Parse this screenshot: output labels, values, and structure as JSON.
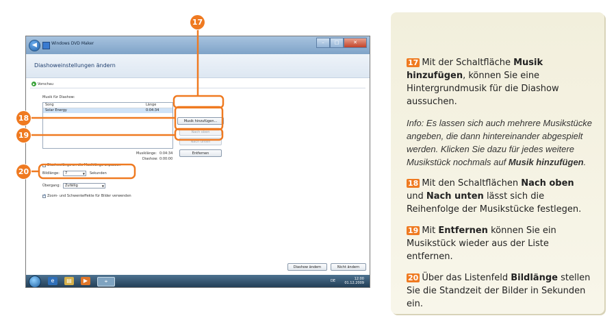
{
  "window": {
    "title": "Windows DVD Maker",
    "heading": "Diashoweinstellungen ändern",
    "preview_label": "Vorschau"
  },
  "music": {
    "section_label": "Musik für Diashow:",
    "columns": [
      "Song",
      "Länge"
    ],
    "rows": [
      {
        "song": "Solar Energy",
        "length": "0:04:34"
      }
    ],
    "add_button": "Musik hinzufügen...",
    "up_button": "Nach oben",
    "down_button": "Nach unten",
    "remove_button": "Entfernen",
    "music_length_label": "Musiklänge:",
    "music_length_value": "0:04:34",
    "slideshow_label": "Diashow:",
    "slideshow_value": "0:00:00"
  },
  "settings": {
    "fit_length_label": "Diashowlänge an die Musiklänge anpassen",
    "fit_length_checked": false,
    "picture_length_label": "Bildlänge:",
    "picture_length_value": "7",
    "picture_length_unit": "Sekunden",
    "transition_label": "Übergang:",
    "transition_value": "Zufällig",
    "zoom_label": "Zoom- und Schwenkeffekte für Bilder verwenden",
    "zoom_checked": true
  },
  "footer": {
    "change_button": "Diashow ändern",
    "cancel_button": "Nicht ändern"
  },
  "taskbar": {
    "language": "DE",
    "time": "12:00",
    "date": "01.12.2009"
  },
  "callouts": [
    "17",
    "18",
    "19",
    "20"
  ],
  "accent_color": "#ef7a21",
  "panel": {
    "p17_num": "17",
    "p17_pre": "Mit der Schaltfläche ",
    "p17_bold": "Musik hinzufügen",
    "p17_post": ", können Sie eine Hintergrundmusik für die Diashow aussuchen.",
    "info_pre": "Info: Es lassen sich auch mehrere Musikstücke angeben, die dann hintereinander abgespielt werden. Klicken Sie dazu für jedes weitere Musikstück nochmals auf ",
    "info_bold": "Musik hinzufügen",
    "info_post": ".",
    "p18_num": "18",
    "p18_pre": "Mit den Schaltflächen ",
    "p18_bold1": "Nach oben",
    "p18_mid": " und ",
    "p18_bold2": "Nach unten",
    "p18_post": " lässt sich die Reihenfolge der Musikstücke festlegen.",
    "p19_num": "19",
    "p19_pre": "Mit ",
    "p19_bold": "Entfernen",
    "p19_post": " können Sie ein Musikstück wieder aus der Liste entfernen.",
    "p20_num": "20",
    "p20_pre": "Über das Listenfeld ",
    "p20_bold": "Bildlänge",
    "p20_post": " stellen Sie die Standzeit der Bilder in Sekunden ein."
  }
}
